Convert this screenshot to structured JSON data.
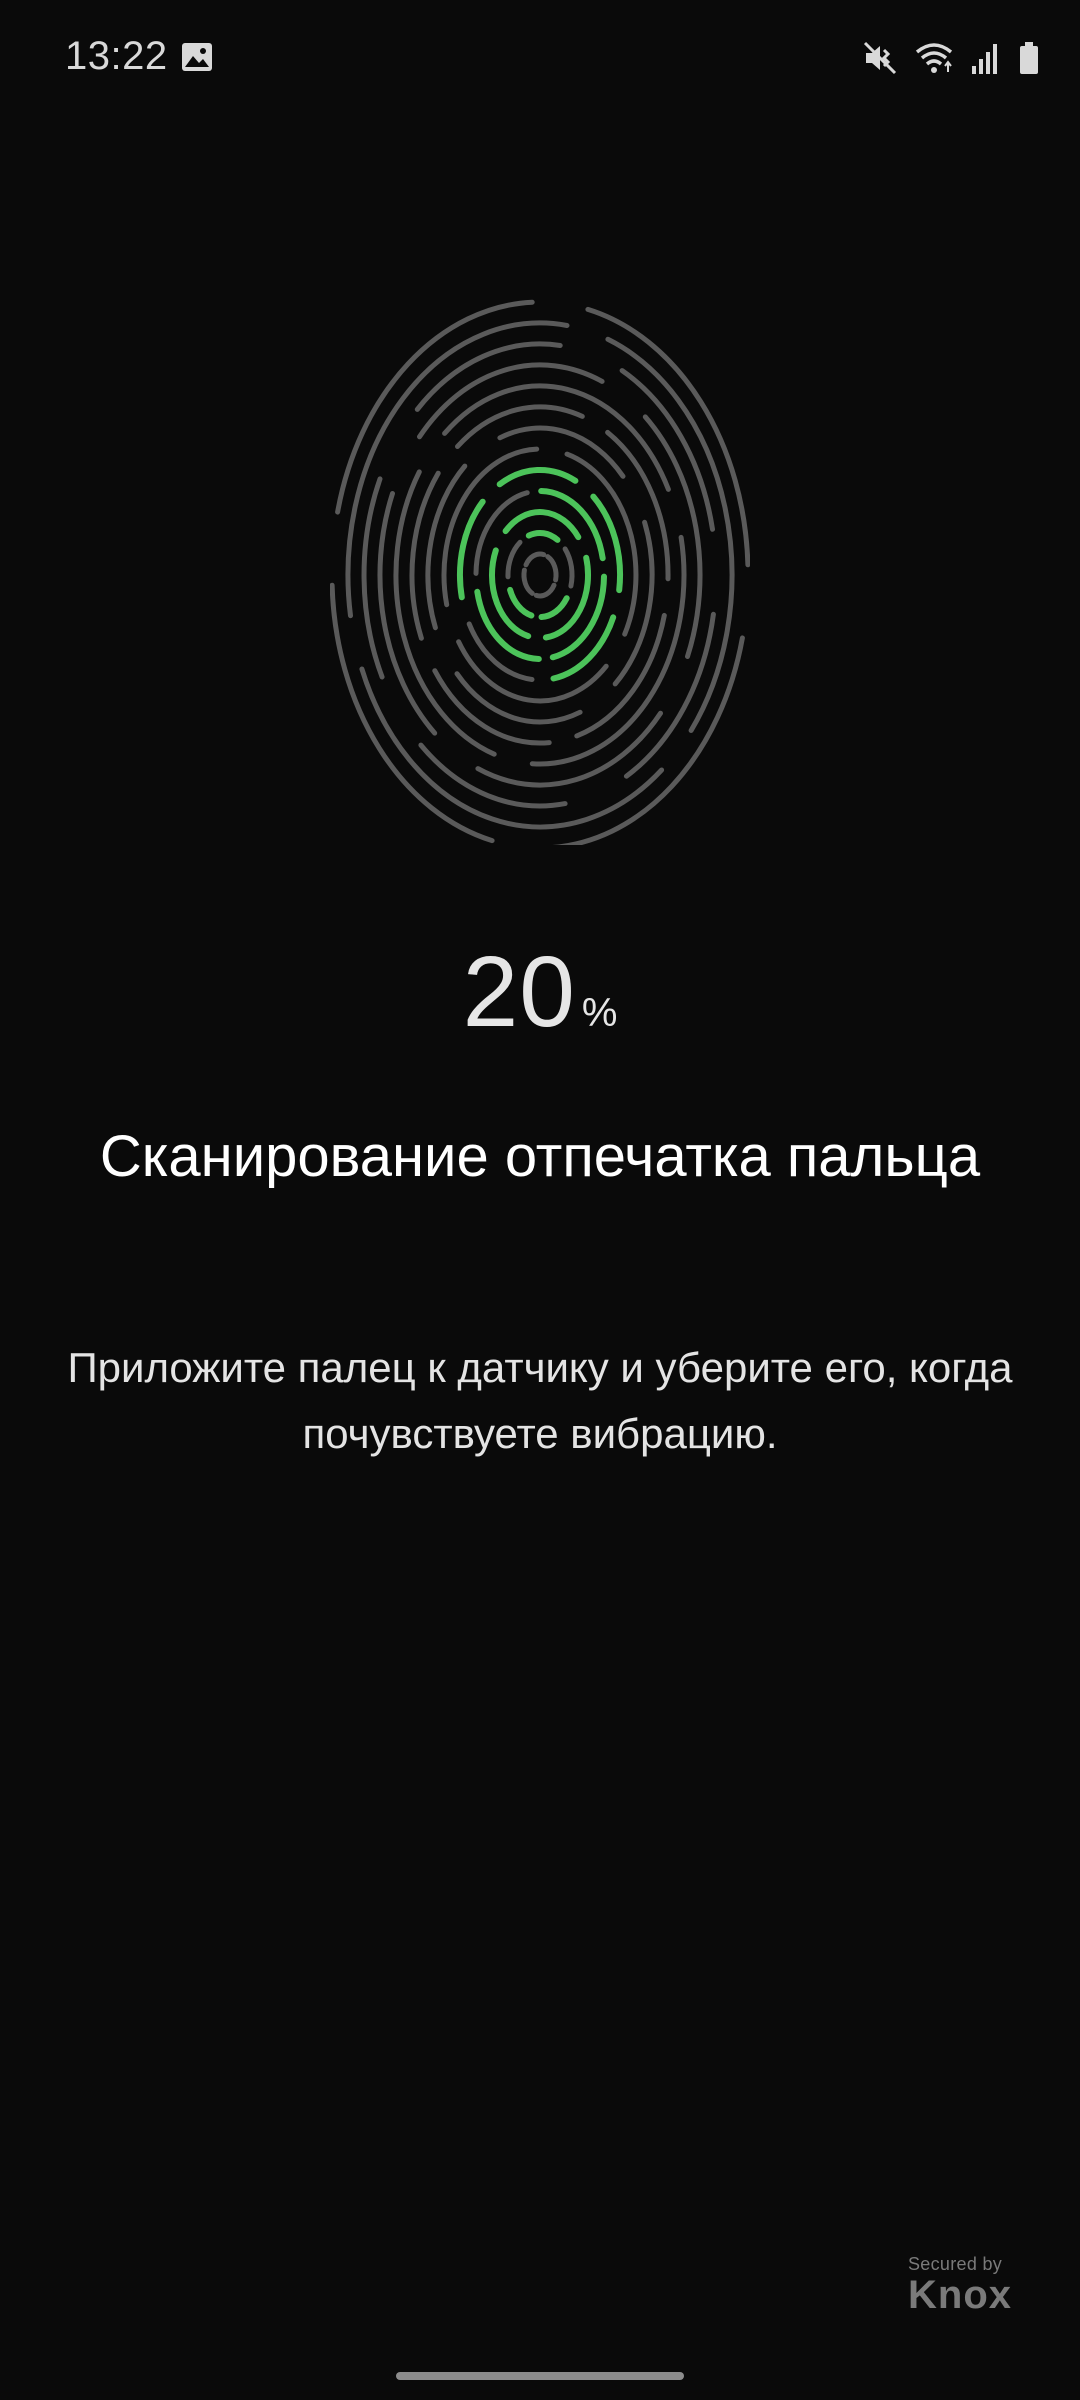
{
  "status_bar": {
    "time": "13:22",
    "icons": [
      "gallery-icon",
      "mute-icon",
      "wifi-icon",
      "signal-icon",
      "battery-icon"
    ]
  },
  "fingerprint": {
    "scan_progress_percent": 20,
    "colors": {
      "scanned": "#4cc35a",
      "unscanned": "#5a5a5a"
    }
  },
  "progress": {
    "value": "20",
    "unit": "%"
  },
  "title": "Сканирование отпечатка пальца",
  "subtitle": "Приложите палец к датчику и уберите его, когда почувствуете вибрацию.",
  "knox": {
    "small": "Secured by",
    "big": "Knox"
  }
}
